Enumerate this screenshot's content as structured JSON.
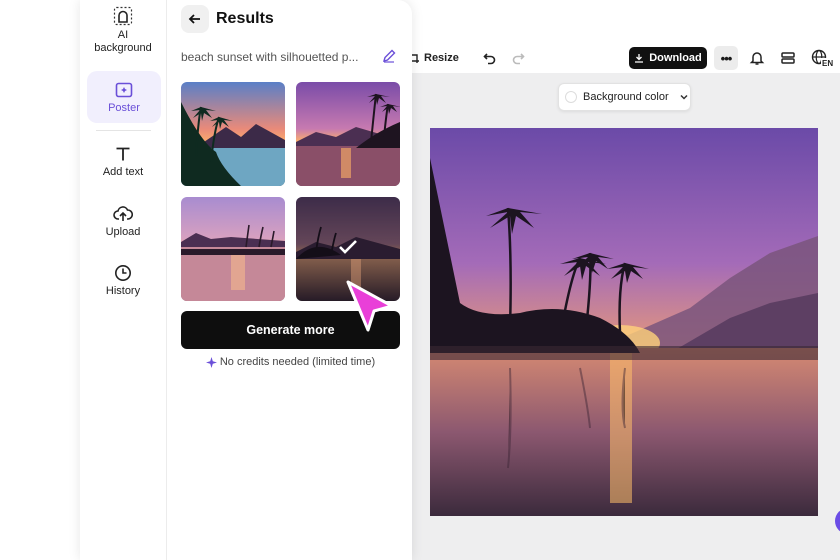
{
  "rail": {
    "ai_background": "AI\nbackground",
    "ai_background_line1": "AI",
    "ai_background_line2": "background",
    "poster": "Poster",
    "add_text": "Add text",
    "upload": "Upload",
    "history": "History"
  },
  "results": {
    "title": "Results",
    "prompt": "beach sunset with silhouetted p...",
    "generate_label": "Generate more",
    "credits_note": "No credits needed (limited time)"
  },
  "toolbar": {
    "resize_label": "Resize",
    "download_label": "Download",
    "more_label": "•••",
    "lang_label": "EN"
  },
  "canvas": {
    "bg_color_label": "Background color"
  },
  "colors": {
    "accent": "#6a4fd8",
    "cursor": "#e93fd8",
    "primary_button": "#0e0e0e"
  },
  "icons": [
    "ai-background-icon",
    "poster-icon",
    "text-icon",
    "upload-icon",
    "history-icon",
    "back-arrow-icon",
    "pencil-icon",
    "check-icon",
    "sparkle-icon",
    "resize-icon",
    "undo-icon",
    "redo-icon",
    "download-icon",
    "bell-icon",
    "layers-icon",
    "globe-icon",
    "chevron-down-icon",
    "pointer-cursor-icon"
  ]
}
